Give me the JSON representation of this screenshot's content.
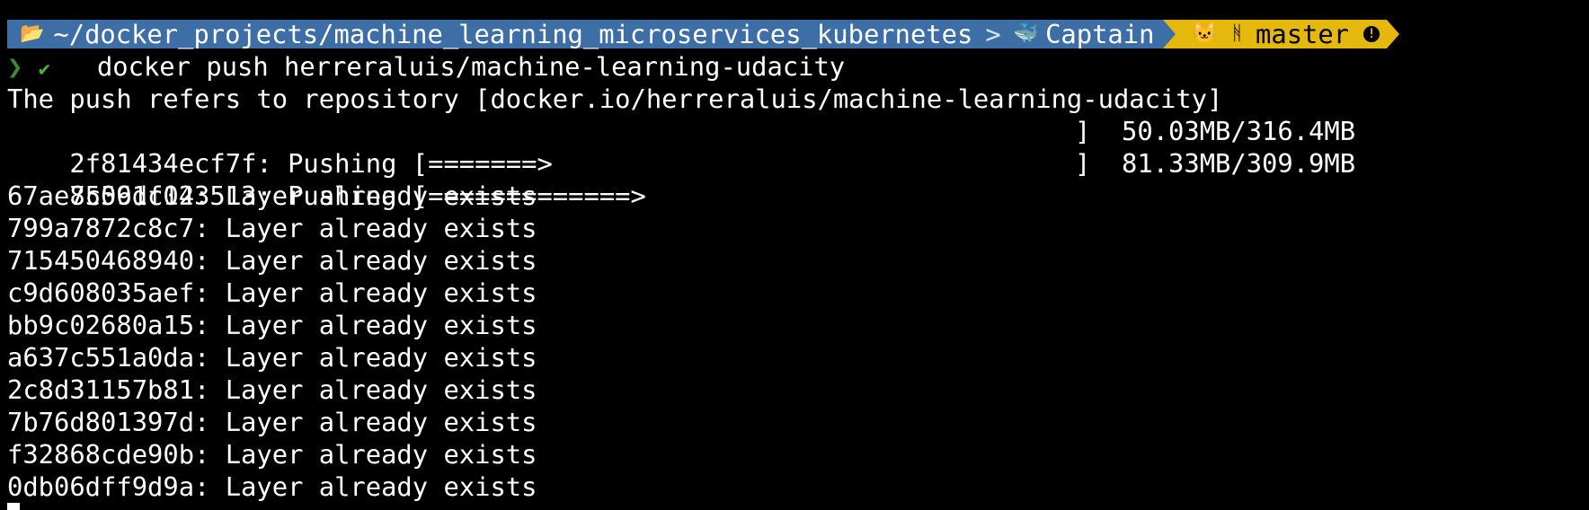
{
  "prompt": {
    "path": "~/docker_projects/machine_learning_microservices_kubernetes",
    "context": "Captain",
    "branch": "master",
    "icons": [
      "folder-icon",
      "whale-icon",
      "github-cat-icon",
      "git-branch-icon",
      "warning-icon"
    ],
    "colors": {
      "path_bg": "#3d6ea6",
      "git_bg": "#e5b80d",
      "check": "#3fbf2f",
      "chevron": "#3d8b2f"
    }
  },
  "command": {
    "chevron": "❯",
    "check": "✔",
    "text": "docker push herreraluis/machine-learning-udacity"
  },
  "output": {
    "header": "The push refers to repository [docker.io/herreraluis/machine-learning-udacity]",
    "pushing": [
      {
        "id": "2f81434ecf7f: Pushing [=======>",
        "progress_text": "]  50.03MB/316.4MB",
        "fraction": 0.158
      },
      {
        "id": "85591c123513: Pushing [=============>",
        "progress_text": "]  81.33MB/309.9MB",
        "fraction": 0.262
      }
    ],
    "existing": [
      "67ae7c06df04: Layer already exists",
      "799a7872c8c7: Layer already exists",
      "715450468940: Layer already exists",
      "c9d608035aef: Layer already exists",
      "bb9c02680a15: Layer already exists",
      "a637c551a0da: Layer already exists",
      "2c8d31157b81: Layer already exists",
      "7b76d801397d: Layer already exists",
      "f32868cde90b: Layer already exists",
      "0db06dff9d9a: Layer already exists"
    ]
  }
}
